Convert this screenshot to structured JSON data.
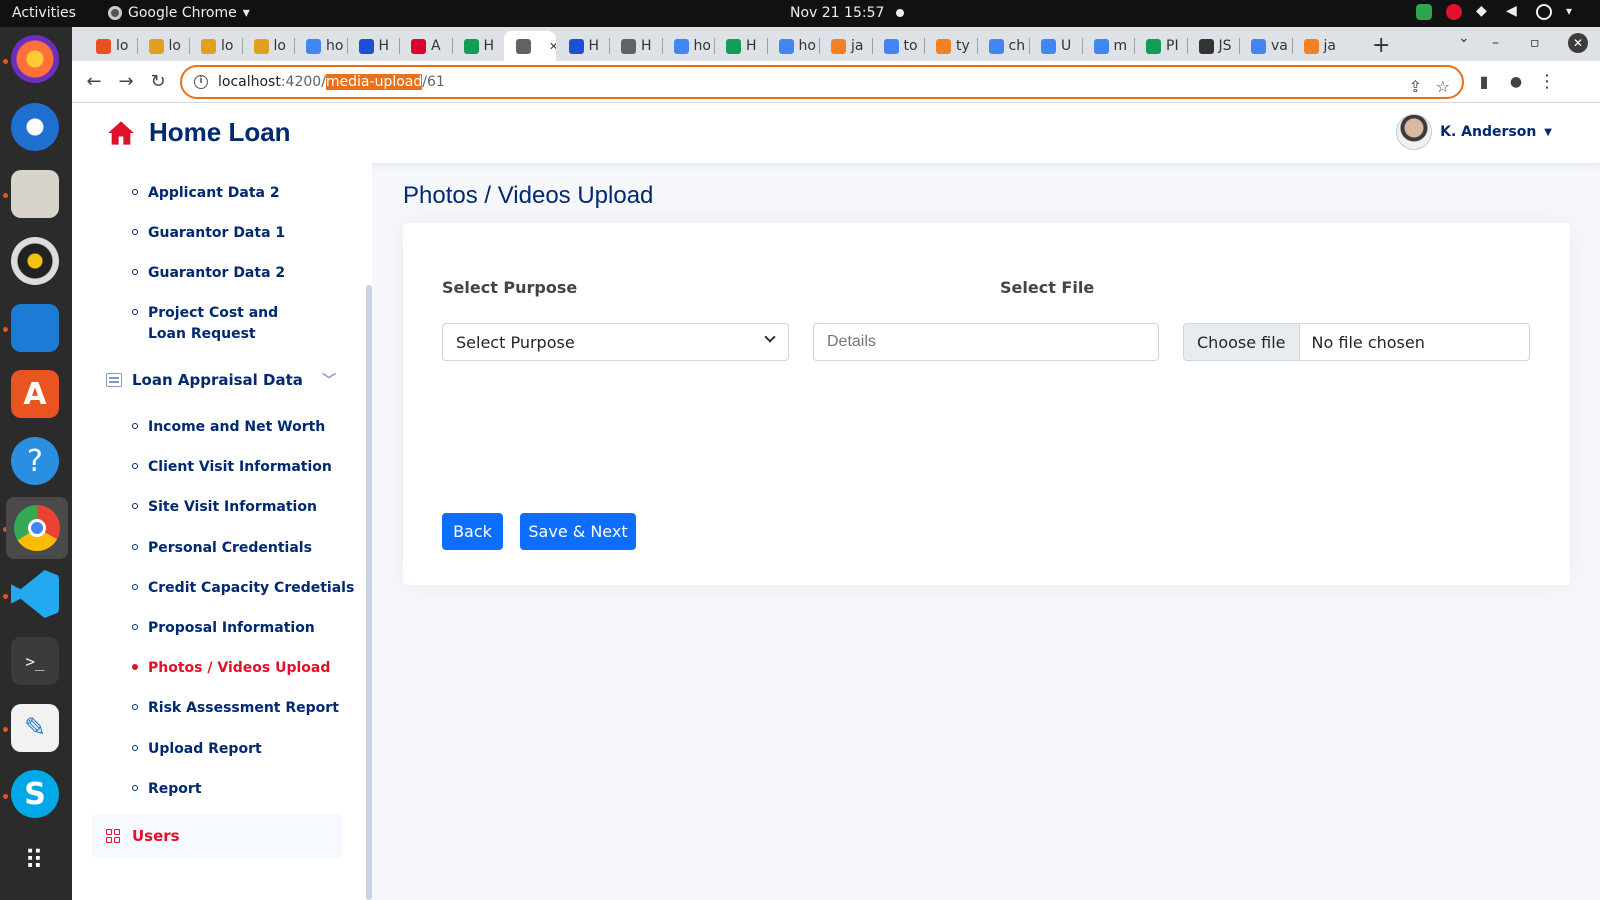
{
  "system": {
    "activities": "Activities",
    "app_name": "Google Chrome",
    "clock": "Nov 21  15:57"
  },
  "dock": {
    "items": [
      "firefox-icon",
      "thunderbird-icon",
      "files-icon",
      "rhythmbox-icon",
      "libreoffice-impress-icon",
      "app-center-icon",
      "help-icon",
      "chrome-icon",
      "vscode-icon",
      "terminal-icon",
      "text-editor-icon",
      "skype-icon",
      "show-apps-icon"
    ]
  },
  "browser": {
    "tabs": [
      {
        "label": "lo",
        "favicon": "#e8511f"
      },
      {
        "label": "lo",
        "favicon": "#e0a020"
      },
      {
        "label": "lo",
        "favicon": "#e0a020"
      },
      {
        "label": "lo",
        "favicon": "#e0a020"
      },
      {
        "label": "ho",
        "favicon": "#4285f4"
      },
      {
        "label": "H",
        "favicon": "#1a4fd6"
      },
      {
        "label": "A",
        "favicon": "#dd0031"
      },
      {
        "label": "H",
        "favicon": "#0f9d58"
      },
      {
        "label": "",
        "favicon": "#5f6368"
      },
      {
        "label": "H",
        "favicon": "#1a4fd6"
      },
      {
        "label": "H",
        "favicon": "#5f6368"
      },
      {
        "label": "ho",
        "favicon": "#4285f4"
      },
      {
        "label": "H",
        "favicon": "#0f9d58"
      },
      {
        "label": "ho",
        "favicon": "#4285f4"
      },
      {
        "label": "ja",
        "favicon": "#f48024"
      },
      {
        "label": "to",
        "favicon": "#4285f4"
      },
      {
        "label": "ty",
        "favicon": "#f48024"
      },
      {
        "label": "ch",
        "favicon": "#4285f4"
      },
      {
        "label": "U",
        "favicon": "#4285f4"
      },
      {
        "label": "m",
        "favicon": "#4285f4"
      },
      {
        "label": "PI",
        "favicon": "#0f9d58"
      },
      {
        "label": "JS",
        "favicon": "#333333"
      },
      {
        "label": "va",
        "favicon": "#4285f4"
      },
      {
        "label": "ja",
        "favicon": "#f48024"
      }
    ],
    "active_tab_index": 8,
    "url": {
      "host": "localhost",
      "port": ":4200/",
      "selected": "media-upload",
      "rest": "/61"
    }
  },
  "app": {
    "title": "Home Loan",
    "user": "K. Anderson"
  },
  "sidebar": {
    "items_top": [
      {
        "label": "Applicant Data 2"
      },
      {
        "label": "Guarantor Data 1"
      },
      {
        "label": "Guarantor Data 2"
      },
      {
        "label": "Project Cost and Loan Request"
      }
    ],
    "group_label": "Loan Appraisal Data",
    "group_items": [
      {
        "label": "Income and Net Worth"
      },
      {
        "label": "Client Visit Information"
      },
      {
        "label": "Site Visit Information"
      },
      {
        "label": "Personal Credentials"
      },
      {
        "label": "Credit Capacity Credetials"
      },
      {
        "label": "Proposal Information"
      },
      {
        "label": "Photos / Videos Upload",
        "active": true
      },
      {
        "label": "Risk Assessment Report"
      },
      {
        "label": "Upload Report"
      },
      {
        "label": "Report"
      }
    ],
    "users_label": "Users"
  },
  "main": {
    "page_title": "Photos / Videos Upload",
    "purpose_label": "Select Purpose",
    "file_label": "Select File",
    "purpose_select_value": "Select Purpose",
    "details_placeholder": "Details",
    "choose_file": "Choose file",
    "no_file": "No file chosen",
    "back_button": "Back",
    "save_button": "Save & Next"
  },
  "colors": {
    "brand_navy": "#012970",
    "accent_red": "#e0112b",
    "primary_button": "#0d6efd",
    "url_highlight": "#e8711a"
  }
}
